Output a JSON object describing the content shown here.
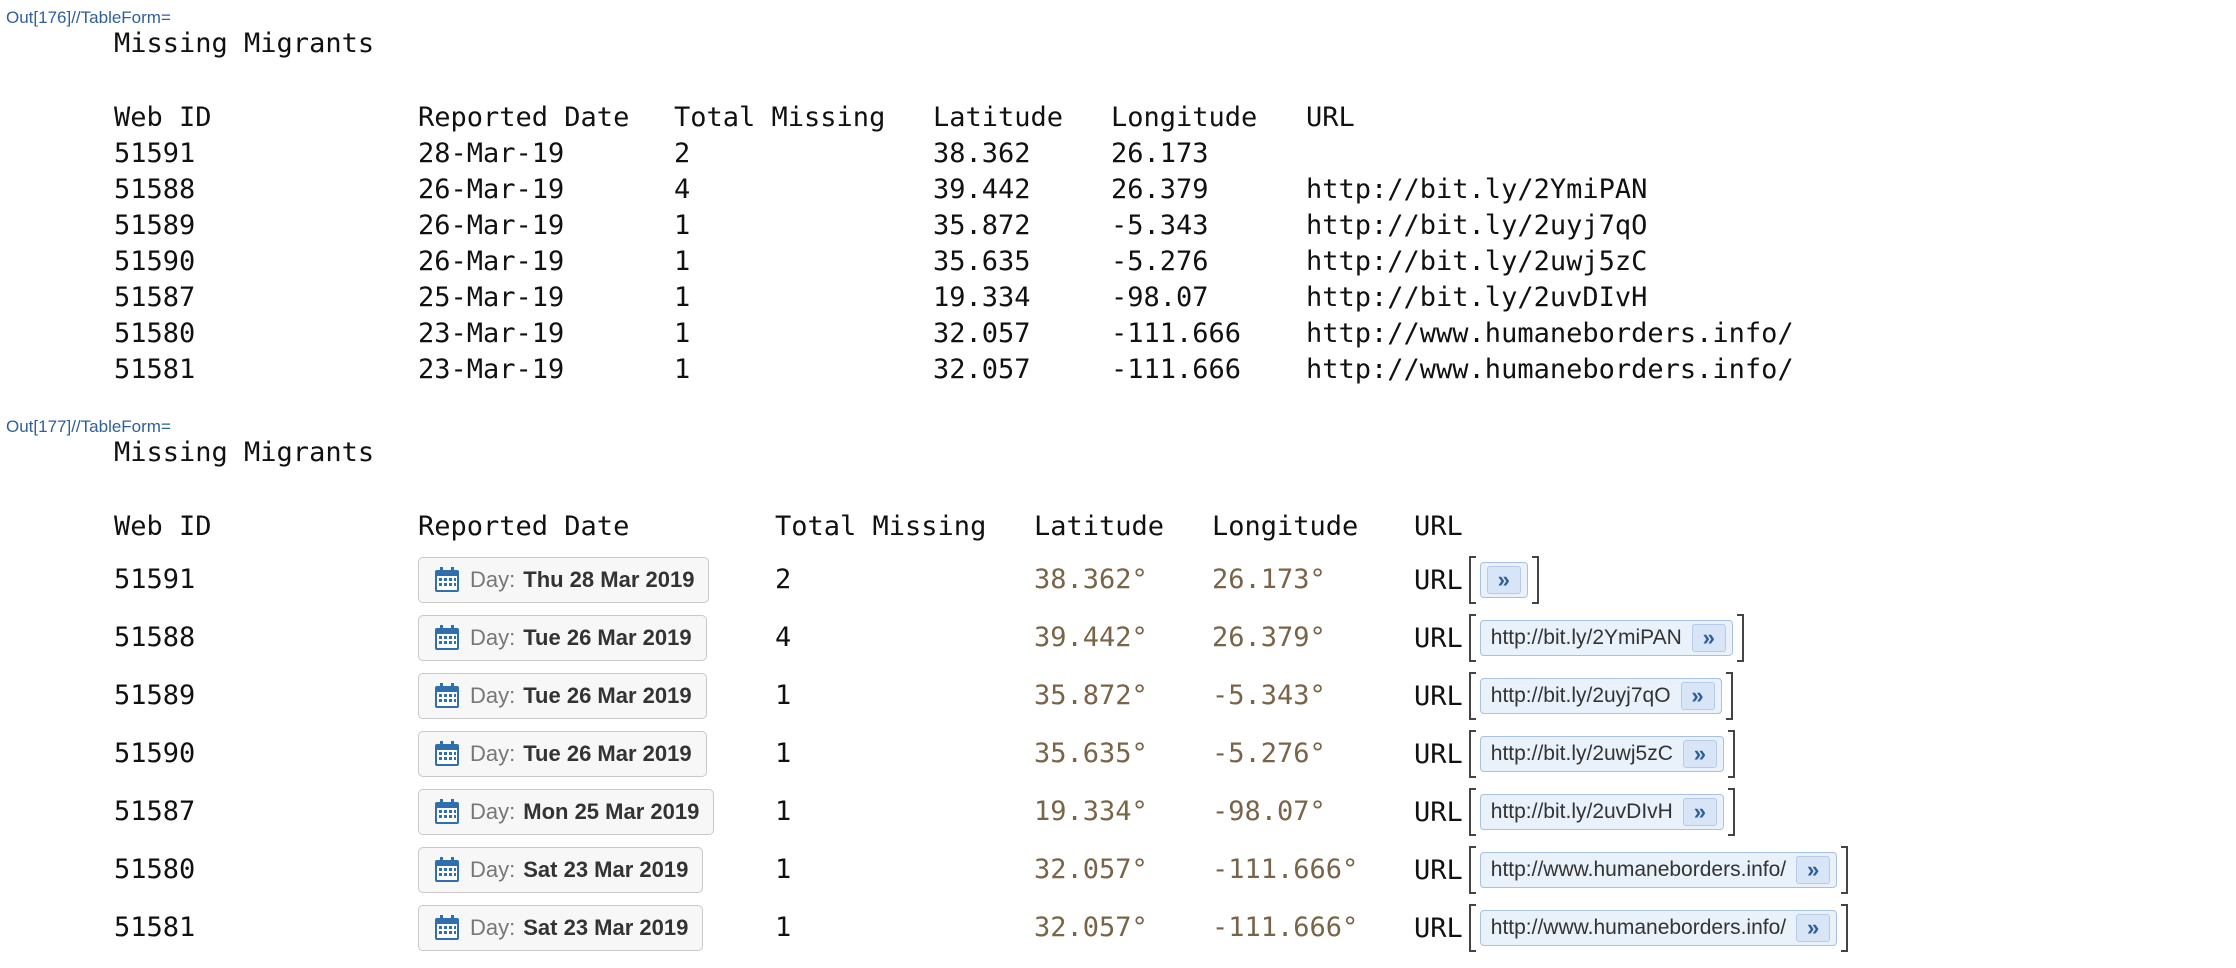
{
  "out176": {
    "label": "Out[176]//TableForm=",
    "title": "Missing Migrants",
    "headers": [
      "Web ID",
      "Reported Date",
      "Total Missing",
      "Latitude",
      "Longitude",
      "URL"
    ],
    "rows": [
      {
        "id": "51591",
        "date": "28-Mar-19",
        "missing": "2",
        "lat": "38.362",
        "lon": "26.173",
        "url": ""
      },
      {
        "id": "51588",
        "date": "26-Mar-19",
        "missing": "4",
        "lat": "39.442",
        "lon": "26.379",
        "url": "http://bit.ly/2YmiPAN"
      },
      {
        "id": "51589",
        "date": "26-Mar-19",
        "missing": "1",
        "lat": "35.872",
        "lon": "-5.343",
        "url": "http://bit.ly/2uyj7qO"
      },
      {
        "id": "51590",
        "date": "26-Mar-19",
        "missing": "1",
        "lat": "35.635",
        "lon": "-5.276",
        "url": "http://bit.ly/2uwj5zC"
      },
      {
        "id": "51587",
        "date": "25-Mar-19",
        "missing": "1",
        "lat": "19.334",
        "lon": "-98.07",
        "url": "http://bit.ly/2uvDIvH"
      },
      {
        "id": "51580",
        "date": "23-Mar-19",
        "missing": "1",
        "lat": "32.057",
        "lon": "-111.666",
        "url": "http://www.humaneborders.info/"
      },
      {
        "id": "51581",
        "date": "23-Mar-19",
        "missing": "1",
        "lat": "32.057",
        "lon": "-111.666",
        "url": "http://www.humaneborders.info/"
      }
    ]
  },
  "out177": {
    "label": "Out[177]//TableForm=",
    "title": "Missing Migrants",
    "headers": [
      "Web ID",
      "Reported Date",
      "Total Missing",
      "Latitude",
      "Longitude",
      "URL"
    ],
    "day_prefix": "Day:",
    "url_label": "URL",
    "go_glyph": "»",
    "rows": [
      {
        "id": "51591",
        "day": "Thu 28 Mar 2019",
        "missing": "2",
        "lat": "38.362°",
        "lon": "26.173°",
        "url": ""
      },
      {
        "id": "51588",
        "day": "Tue 26 Mar 2019",
        "missing": "4",
        "lat": "39.442°",
        "lon": "26.379°",
        "url": "http://bit.ly/2YmiPAN"
      },
      {
        "id": "51589",
        "day": "Tue 26 Mar 2019",
        "missing": "1",
        "lat": "35.872°",
        "lon": "-5.343°",
        "url": "http://bit.ly/2uyj7qO"
      },
      {
        "id": "51590",
        "day": "Tue 26 Mar 2019",
        "missing": "1",
        "lat": "35.635°",
        "lon": "-5.276°",
        "url": "http://bit.ly/2uwj5zC"
      },
      {
        "id": "51587",
        "day": "Mon 25 Mar 2019",
        "missing": "1",
        "lat": "19.334°",
        "lon": "-98.07°",
        "url": "http://bit.ly/2uvDIvH"
      },
      {
        "id": "51580",
        "day": "Sat 23 Mar 2019",
        "missing": "1",
        "lat": "32.057°",
        "lon": "-111.666°",
        "url": "http://www.humaneborders.info/"
      },
      {
        "id": "51581",
        "day": "Sat 23 Mar 2019",
        "missing": "1",
        "lat": "32.057°",
        "lon": "-111.666°",
        "url": "http://www.humaneborders.info/"
      }
    ]
  },
  "colors": {
    "label_blue": "#2f5f9a",
    "quantity_brown": "#7a6448",
    "button_bg": "#e9f1fb"
  }
}
